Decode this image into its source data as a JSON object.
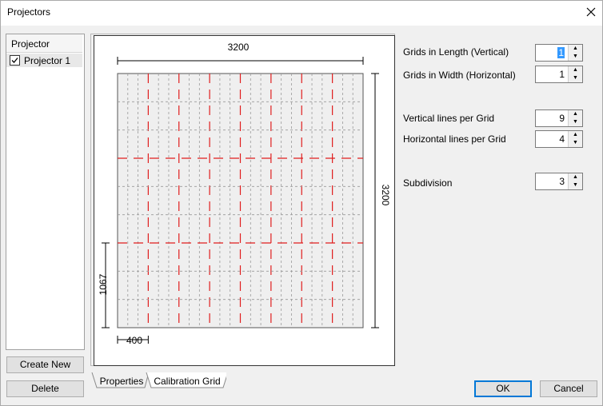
{
  "window": {
    "title": "Projectors"
  },
  "projector_list": {
    "header": "Projector",
    "items": [
      {
        "label": "Projector 1",
        "checked": true
      }
    ]
  },
  "buttons": {
    "create_new": "Create New",
    "delete": "Delete",
    "ok": "OK",
    "cancel": "Cancel"
  },
  "tabs": [
    {
      "label": "Properties",
      "active": false
    },
    {
      "label": "Calibration Grid",
      "active": true
    }
  ],
  "grid_preview": {
    "width_label": "3200",
    "height_label": "3200",
    "cell_height_label": "1067",
    "cell_width_label": "400"
  },
  "settings": {
    "grids_length": {
      "label": "Grids in Length (Vertical)",
      "value": "1"
    },
    "grids_width": {
      "label": "Grids in Width (Horizontal)",
      "value": "1"
    },
    "vertical_lines": {
      "label": "Vertical lines per Grid",
      "value": "9"
    },
    "horizontal_lines": {
      "label": "Horizontal lines per Grid",
      "value": "4"
    },
    "subdivision": {
      "label": "Subdivision",
      "value": "3"
    }
  },
  "colors": {
    "grid_major": "#e01e1e",
    "grid_minor": "#9a9a9a",
    "accent": "#0078d7"
  }
}
